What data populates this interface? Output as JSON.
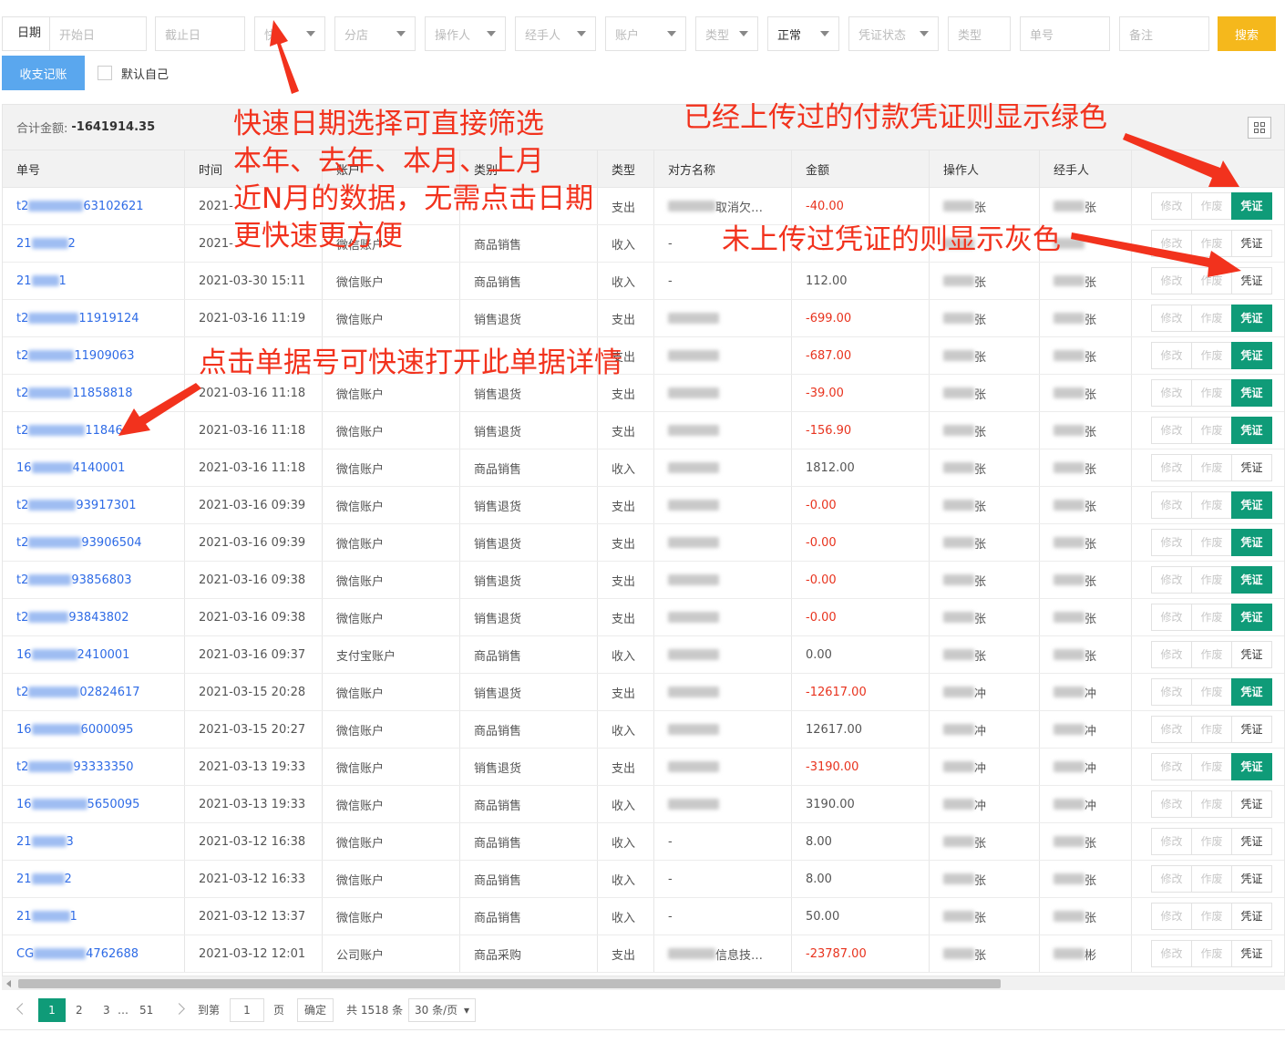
{
  "filters": {
    "date_label": "日期",
    "start_placeholder": "开始日",
    "end_placeholder": "截止日",
    "quick": "快",
    "branch": "分店",
    "operator": "操作人",
    "handler": "经手人",
    "account": "账户",
    "type": "类型",
    "status": "正常",
    "voucher_status": "凭证状态",
    "type2": "类型",
    "doc_no": "单号",
    "remark": "备注",
    "search": "搜索",
    "record_button": "收支记账",
    "default_self": "默认自己"
  },
  "summary": {
    "label": "合计金额:",
    "total": "-1641914.35"
  },
  "columns": [
    "单号",
    "时间",
    "账户",
    "类别",
    "类型",
    "对方名称",
    "金额",
    "操作人",
    "经手人"
  ],
  "actions": {
    "edit": "修改",
    "void": "作废",
    "voucher": "凭证"
  },
  "rows": [
    {
      "no_prefix": "t2",
      "no_suffix": "63102621",
      "time": "2021-",
      "account": "",
      "category": "",
      "type": "支出",
      "party": "取消欠…",
      "amount": "-40.00",
      "operator": "张",
      "handler": "张",
      "voucher": true
    },
    {
      "no_prefix": "21",
      "no_suffix": "2",
      "time": "2021-",
      "account": "微信账户",
      "category": "商品销售",
      "type": "收入",
      "party": "-",
      "amount": "",
      "operator": "",
      "handler": "",
      "voucher": false
    },
    {
      "no_prefix": "21",
      "no_suffix": "1",
      "time": "2021-03-30 15:11",
      "account": "微信账户",
      "category": "商品销售",
      "type": "收入",
      "party": "-",
      "amount": "112.00",
      "operator": "张",
      "handler": "张",
      "voucher": false
    },
    {
      "no_prefix": "t2",
      "no_suffix": "11919124",
      "time": "2021-03-16 11:19",
      "account": "微信账户",
      "category": "销售退货",
      "type": "支出",
      "party": "",
      "amount": "-699.00",
      "operator": "张",
      "handler": "张",
      "voucher": true
    },
    {
      "no_prefix": "t2",
      "no_suffix": "11909063",
      "time": "",
      "account": "",
      "category": "",
      "type": "支出",
      "party": "",
      "amount": "-687.00",
      "operator": "张",
      "handler": "张",
      "voucher": true
    },
    {
      "no_prefix": "t2",
      "no_suffix": "11858818",
      "time": "2021-03-16 11:18",
      "account": "微信账户",
      "category": "销售退货",
      "type": "支出",
      "party": "",
      "amount": "-39.00",
      "operator": "张",
      "handler": "张",
      "voucher": true
    },
    {
      "no_prefix": "t2",
      "no_suffix": "11846",
      "time": "2021-03-16 11:18",
      "account": "微信账户",
      "category": "销售退货",
      "type": "支出",
      "party": "",
      "amount": "-156.90",
      "operator": "张",
      "handler": "张",
      "voucher": true
    },
    {
      "no_prefix": "16",
      "no_suffix": "4140001",
      "time": "2021-03-16 11:18",
      "account": "微信账户",
      "category": "商品销售",
      "type": "收入",
      "party": "",
      "amount": "1812.00",
      "operator": "张",
      "handler": "张",
      "voucher": false
    },
    {
      "no_prefix": "t2",
      "no_suffix": "93917301",
      "time": "2021-03-16 09:39",
      "account": "微信账户",
      "category": "销售退货",
      "type": "支出",
      "party": "",
      "amount": "-0.00",
      "operator": "张",
      "handler": "张",
      "voucher": true
    },
    {
      "no_prefix": "t2",
      "no_suffix": "93906504",
      "time": "2021-03-16 09:39",
      "account": "微信账户",
      "category": "销售退货",
      "type": "支出",
      "party": "",
      "amount": "-0.00",
      "operator": "张",
      "handler": "张",
      "voucher": true
    },
    {
      "no_prefix": "t2",
      "no_suffix": "93856803",
      "time": "2021-03-16 09:38",
      "account": "微信账户",
      "category": "销售退货",
      "type": "支出",
      "party": "",
      "amount": "-0.00",
      "operator": "张",
      "handler": "张",
      "voucher": true
    },
    {
      "no_prefix": "t2",
      "no_suffix": "93843802",
      "time": "2021-03-16 09:38",
      "account": "微信账户",
      "category": "销售退货",
      "type": "支出",
      "party": "",
      "amount": "-0.00",
      "operator": "张",
      "handler": "张",
      "voucher": true
    },
    {
      "no_prefix": "16",
      "no_suffix": "2410001",
      "time": "2021-03-16 09:37",
      "account": "支付宝账户",
      "category": "商品销售",
      "type": "收入",
      "party": "",
      "amount": "0.00",
      "operator": "张",
      "handler": "张",
      "voucher": false
    },
    {
      "no_prefix": "t2",
      "no_suffix": "02824617",
      "time": "2021-03-15 20:28",
      "account": "微信账户",
      "category": "销售退货",
      "type": "支出",
      "party": "",
      "amount": "-12617.00",
      "operator": "冲",
      "handler": "冲",
      "voucher": true
    },
    {
      "no_prefix": "16",
      "no_suffix": "6000095",
      "time": "2021-03-15 20:27",
      "account": "微信账户",
      "category": "商品销售",
      "type": "收入",
      "party": "",
      "amount": "12617.00",
      "operator": "冲",
      "handler": "冲",
      "voucher": false
    },
    {
      "no_prefix": "t2",
      "no_suffix": "93333350",
      "time": "2021-03-13 19:33",
      "account": "微信账户",
      "category": "销售退货",
      "type": "支出",
      "party": "",
      "amount": "-3190.00",
      "operator": "冲",
      "handler": "冲",
      "voucher": true
    },
    {
      "no_prefix": "16",
      "no_suffix": "5650095",
      "time": "2021-03-13 19:33",
      "account": "微信账户",
      "category": "商品销售",
      "type": "收入",
      "party": "",
      "amount": "3190.00",
      "operator": "冲",
      "handler": "冲",
      "voucher": false
    },
    {
      "no_prefix": "21",
      "no_suffix": "3",
      "time": "2021-03-12 16:38",
      "account": "微信账户",
      "category": "商品销售",
      "type": "收入",
      "party": "-",
      "amount": "8.00",
      "operator": "张",
      "handler": "张",
      "voucher": false
    },
    {
      "no_prefix": "21",
      "no_suffix": "2",
      "time": "2021-03-12 16:33",
      "account": "微信账户",
      "category": "商品销售",
      "type": "收入",
      "party": "-",
      "amount": "8.00",
      "operator": "张",
      "handler": "张",
      "voucher": false
    },
    {
      "no_prefix": "21",
      "no_suffix": "1",
      "time": "2021-03-12 13:37",
      "account": "微信账户",
      "category": "商品销售",
      "type": "收入",
      "party": "-",
      "amount": "50.00",
      "operator": "张",
      "handler": "张",
      "voucher": false
    },
    {
      "no_prefix": "CG",
      "no_suffix": "4762688",
      "time": "2021-03-12 12:01",
      "account": "公司账户",
      "category": "商品采购",
      "type": "支出",
      "party": "信息技…",
      "amount": "-23787.00",
      "operator": "张",
      "handler": "彬",
      "voucher": false
    }
  ],
  "pagination": {
    "current": "1",
    "p2": "2",
    "p3": "3",
    "ellipsis": "…",
    "last": "51",
    "goto_label": "到第",
    "goto_value": "1",
    "page_unit": "页",
    "confirm": "确定",
    "total": "共 1518 条",
    "page_size": "30 条/页"
  },
  "annotations": {
    "quick_date_1": "快速日期选择可直接筛选",
    "quick_date_2": "本年、去年、本月、上月",
    "quick_date_3": "近N月的数据，无需点击日期",
    "quick_date_4": "更快速更方便",
    "green_voucher": "已经上传过的付款凭证则显示绿色",
    "gray_voucher": "未上传过凭证的则显示灰色",
    "click_no": "点击单据号可快速打开此单据详情"
  },
  "colors": {
    "voucher_done": "#0f9b78",
    "search_button": "#f5b81c",
    "record_button": "#5aa7ee",
    "link": "#2e6be6",
    "negative": "#e8331e",
    "annotation": "#f2321d"
  }
}
